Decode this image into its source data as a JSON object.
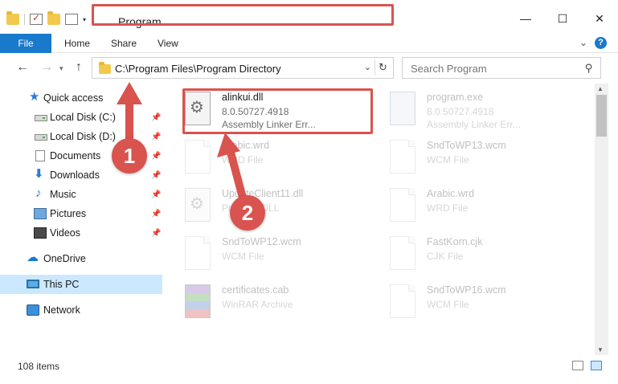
{
  "window": {
    "title": "Program",
    "minimize_glyph": "—",
    "maximize_glyph": "☐",
    "close_glyph": "✕"
  },
  "ribbon": {
    "tabs": [
      "File",
      "Home",
      "Share",
      "View"
    ],
    "help_glyph": "?",
    "collapse_glyph": "⌄"
  },
  "navigation": {
    "back_glyph": "←",
    "forward_glyph": "→",
    "history_glyph": "▾",
    "up_glyph": "↑",
    "address": "C:\\Program Files\\Program Directory",
    "dropdown_glyph": "⌄",
    "refresh_glyph": "↻",
    "search_placeholder": "Search Program",
    "search_glyph": "⚲"
  },
  "sidebar": {
    "items": [
      {
        "label": "Quick access",
        "icon": "star-icon",
        "glyph": "★",
        "pinned": false
      },
      {
        "label": "Local Disk (C:)",
        "icon": "disk-icon",
        "glyph": "",
        "pinned": true
      },
      {
        "label": "Local Disk (D:)",
        "icon": "disk-icon",
        "glyph": "",
        "pinned": true
      },
      {
        "label": "Documents",
        "icon": "document-icon",
        "glyph": "",
        "pinned": true
      },
      {
        "label": "Downloads",
        "icon": "download-icon",
        "glyph": "⬇",
        "pinned": true
      },
      {
        "label": "Music",
        "icon": "music-icon",
        "glyph": "♪",
        "pinned": true
      },
      {
        "label": "Pictures",
        "icon": "pictures-icon",
        "glyph": "",
        "pinned": true
      },
      {
        "label": "Videos",
        "icon": "videos-icon",
        "glyph": "",
        "pinned": true
      },
      {
        "label": "OneDrive",
        "icon": "cloud-icon",
        "glyph": "☁",
        "pinned": false
      },
      {
        "label": "This PC",
        "icon": "pc-icon",
        "glyph": "",
        "pinned": false,
        "selected": true
      },
      {
        "label": "Network",
        "icon": "network-icon",
        "glyph": "",
        "pinned": false
      }
    ],
    "pin_glyph": "📌"
  },
  "files": [
    {
      "name": "alinkui.dll",
      "meta1": "8.0.50727.4918",
      "meta2": "Assembly Linker Err...",
      "icon": "dll-icon",
      "highlighted": true
    },
    {
      "name": "program.exe",
      "meta1": "8.0.50727.4918",
      "meta2": "Assembly Linker Err...",
      "icon": "exe-icon",
      "highlighted": false
    },
    {
      "name": "Arabic.wrd",
      "meta1": "WRD File",
      "meta2": "",
      "icon": "document-icon",
      "highlighted": false
    },
    {
      "name": "SndToWP13.wcm",
      "meta1": "WCM File",
      "meta2": "",
      "icon": "document-icon",
      "highlighted": false
    },
    {
      "name": "UpdateClient11.dll",
      "meta1": "Program DLL",
      "meta2": "",
      "icon": "dll-icon",
      "highlighted": false
    },
    {
      "name": "Arabic.wrd",
      "meta1": "WRD File",
      "meta2": "",
      "icon": "document-icon",
      "highlighted": false
    },
    {
      "name": "SndToWP12.wcm",
      "meta1": "WCM File",
      "meta2": "",
      "icon": "document-icon",
      "highlighted": false
    },
    {
      "name": "FastKorn.cjk",
      "meta1": "CJK File",
      "meta2": "",
      "icon": "document-icon",
      "highlighted": false
    },
    {
      "name": "certificates.cab",
      "meta1": "WinRAR Archive",
      "meta2": "",
      "icon": "archive-icon",
      "highlighted": false
    },
    {
      "name": "SndToWP16.wcm",
      "meta1": "WCM File",
      "meta2": "",
      "icon": "document-icon",
      "highlighted": false
    }
  ],
  "dll_glyph": "⚙",
  "scrollbar": {
    "up_glyph": "▲",
    "down_glyph": "▼"
  },
  "status": {
    "item_count": "108 items"
  },
  "callouts": [
    "1",
    "2"
  ],
  "colors": {
    "accent": "#1979ca",
    "callout": "#d9534f",
    "selection": "#cce8ff"
  }
}
